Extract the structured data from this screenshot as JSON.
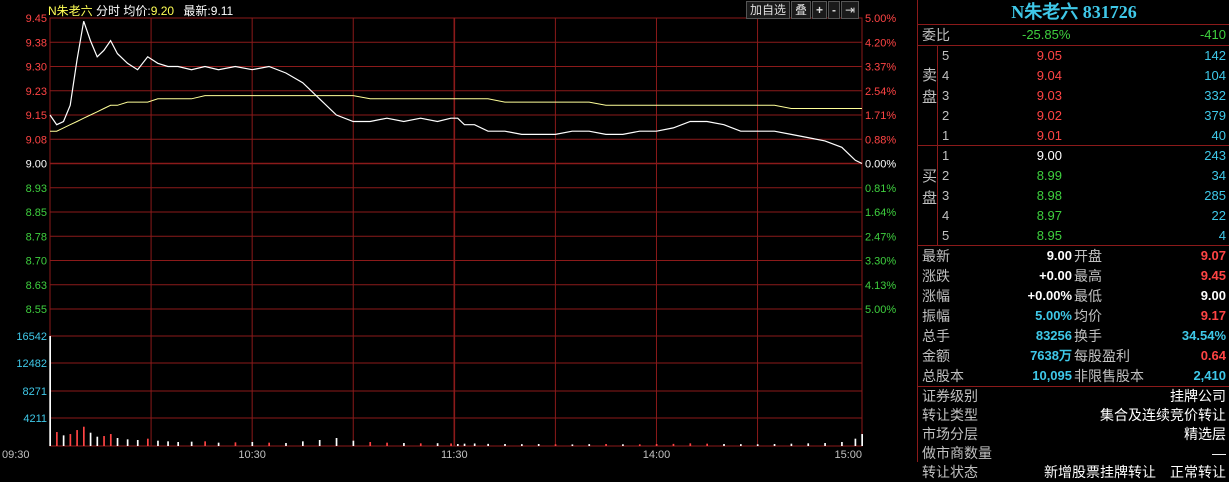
{
  "header": {
    "stock_name": "N朱老六",
    "mode": "分时",
    "avg_label": "均价:",
    "avg_value": "9.20",
    "last_label": "最新:",
    "last_value": "9.11"
  },
  "toolbar": {
    "add_watch": "加自选",
    "overlay": "叠",
    "zoom_in": "+",
    "zoom_out": "-",
    "nav_end": "⇥"
  },
  "colors": {
    "up": "#ff4444",
    "down": "#3ecf3e",
    "price_line": "#ffffff",
    "avg_line": "#ffff99",
    "grid": "#8b1a1a",
    "cyan": "#3fc8e8"
  },
  "chart_data": {
    "type": "line",
    "title": "",
    "prev_close": 9.0,
    "price_axis": {
      "ticks": [
        "9.45",
        "9.38",
        "9.30",
        "9.23",
        "9.15",
        "9.08",
        "9.00",
        "8.93",
        "8.85",
        "8.78",
        "8.70",
        "8.63",
        "8.55"
      ],
      "pct_ticks": [
        "5.00%",
        "4.20%",
        "3.37%",
        "2.54%",
        "1.71%",
        "0.88%",
        "0.00%",
        "0.81%",
        "1.64%",
        "2.47%",
        "3.30%",
        "4.13%",
        "5.00%"
      ],
      "range": [
        8.55,
        9.45
      ]
    },
    "volume_axis": {
      "ticks": [
        "16542",
        "12482",
        "8271",
        "4211"
      ],
      "range": [
        0,
        20600
      ]
    },
    "time_ticks": [
      "09:30",
      "10:30",
      "11:30",
      "14:00",
      "15:00"
    ],
    "minutes": [
      0,
      2,
      4,
      6,
      8,
      10,
      12,
      14,
      16,
      18,
      20,
      23,
      26,
      29,
      32,
      35,
      38,
      42,
      46,
      50,
      55,
      60,
      65,
      70,
      75,
      80,
      85,
      90,
      95,
      100,
      105,
      110,
      115,
      119,
      121,
      123,
      126,
      130,
      135,
      140,
      145,
      150,
      155,
      160,
      165,
      170,
      175,
      180,
      185,
      190,
      195,
      200,
      205,
      210,
      215,
      220,
      225,
      230,
      235,
      239,
      241
    ],
    "price": [
      9.15,
      9.12,
      9.13,
      9.18,
      9.32,
      9.44,
      9.38,
      9.33,
      9.35,
      9.38,
      9.34,
      9.31,
      9.29,
      9.33,
      9.31,
      9.3,
      9.3,
      9.29,
      9.3,
      9.29,
      9.3,
      9.29,
      9.3,
      9.28,
      9.25,
      9.2,
      9.15,
      9.13,
      9.13,
      9.14,
      9.13,
      9.14,
      9.13,
      9.14,
      9.14,
      9.12,
      9.12,
      9.1,
      9.1,
      9.09,
      9.09,
      9.09,
      9.1,
      9.1,
      9.09,
      9.09,
      9.1,
      9.1,
      9.11,
      9.13,
      9.13,
      9.12,
      9.1,
      9.1,
      9.1,
      9.09,
      9.08,
      9.07,
      9.05,
      9.01,
      9.0
    ],
    "avg": [
      9.1,
      9.1,
      9.11,
      9.12,
      9.13,
      9.14,
      9.15,
      9.16,
      9.17,
      9.18,
      9.18,
      9.19,
      9.19,
      9.19,
      9.2,
      9.2,
      9.2,
      9.2,
      9.21,
      9.21,
      9.21,
      9.21,
      9.21,
      9.21,
      9.21,
      9.21,
      9.21,
      9.21,
      9.2,
      9.2,
      9.2,
      9.2,
      9.2,
      9.2,
      9.2,
      9.2,
      9.2,
      9.2,
      9.19,
      9.19,
      9.19,
      9.19,
      9.19,
      9.19,
      9.18,
      9.18,
      9.18,
      9.18,
      9.18,
      9.18,
      9.18,
      9.18,
      9.18,
      9.18,
      9.18,
      9.17,
      9.17,
      9.17,
      9.17,
      9.17,
      9.17
    ],
    "volume": [
      16542,
      2100,
      1600,
      1800,
      2400,
      2900,
      2000,
      1400,
      1500,
      1800,
      1200,
      1000,
      900,
      1100,
      800,
      700,
      600,
      650,
      700,
      500,
      550,
      600,
      500,
      450,
      700,
      900,
      1200,
      800,
      600,
      500,
      450,
      400,
      420,
      380,
      300,
      350,
      380,
      320,
      300,
      280,
      300,
      260,
      240,
      280,
      300,
      260,
      250,
      300,
      320,
      400,
      350,
      300,
      280,
      260,
      300,
      350,
      400,
      450,
      600,
      1100,
      1800
    ],
    "volume_color": [
      "white",
      "red",
      "white",
      "red",
      "red",
      "red",
      "white",
      "white",
      "red",
      "red",
      "white",
      "white",
      "white",
      "red",
      "white",
      "white",
      "white",
      "white",
      "red",
      "white",
      "red",
      "white",
      "red",
      "white",
      "white",
      "white",
      "white",
      "white",
      "red",
      "red",
      "white",
      "red",
      "white",
      "red",
      "white",
      "white",
      "white",
      "white",
      "white",
      "white",
      "white",
      "red",
      "white",
      "white",
      "red",
      "white",
      "red",
      "red",
      "red",
      "red",
      "red",
      "white",
      "white",
      "white",
      "white",
      "white",
      "white",
      "white",
      "white",
      "white",
      "white"
    ]
  },
  "panel": {
    "title": "N朱老六  831726",
    "webi": {
      "label": "委比",
      "pct": "-25.85%",
      "diff": "-410"
    },
    "sell_label": "卖盘",
    "buy_label": "买盘",
    "asks": [
      {
        "level": "5",
        "price": "9.05",
        "vol": "142"
      },
      {
        "level": "4",
        "price": "9.04",
        "vol": "104"
      },
      {
        "level": "3",
        "price": "9.03",
        "vol": "332"
      },
      {
        "level": "2",
        "price": "9.02",
        "vol": "379"
      },
      {
        "level": "1",
        "price": "9.01",
        "vol": "40"
      }
    ],
    "bids": [
      {
        "level": "1",
        "price": "9.00",
        "vol": "243"
      },
      {
        "level": "2",
        "price": "8.99",
        "vol": "34"
      },
      {
        "level": "3",
        "price": "8.98",
        "vol": "285"
      },
      {
        "level": "4",
        "price": "8.97",
        "vol": "22"
      },
      {
        "level": "5",
        "price": "8.95",
        "vol": "4"
      }
    ],
    "stats": [
      {
        "l1": "最新",
        "v1": "9.00",
        "c1": "white",
        "l2": "开盘",
        "v2": "9.07",
        "c2": "red"
      },
      {
        "l1": "涨跌",
        "v1": "+0.00",
        "c1": "white",
        "l2": "最高",
        "v2": "9.45",
        "c2": "red"
      },
      {
        "l1": "涨幅",
        "v1": "+0.00%",
        "c1": "white",
        "l2": "最低",
        "v2": "9.00",
        "c2": "white"
      },
      {
        "l1": "振幅",
        "v1": "5.00%",
        "c1": "cyan",
        "l2": "均价",
        "v2": "9.17",
        "c2": "red"
      },
      {
        "l1": "总手",
        "v1": "83256",
        "c1": "cyan",
        "l2": "换手",
        "v2": "34.54%",
        "c2": "cyan"
      },
      {
        "l1": "金额",
        "v1": "7638万",
        "c1": "cyan",
        "l2": "每股盈利",
        "v2": "0.64",
        "c2": "red"
      },
      {
        "l1": "总股本",
        "v1": "10,095",
        "c1": "cyan",
        "l2": "非限售股本",
        "v2": "2,410",
        "c2": "cyan"
      }
    ],
    "info": [
      {
        "label": "证券级别",
        "value": "挂牌公司"
      },
      {
        "label": "转让类型",
        "value": "集合及连续竞价转让"
      },
      {
        "label": "市场分层",
        "value": "精选层"
      },
      {
        "label": "做市商数量",
        "value": "—"
      },
      {
        "label": "转让状态",
        "value": "新增股票挂牌转让　正常转让"
      }
    ]
  }
}
